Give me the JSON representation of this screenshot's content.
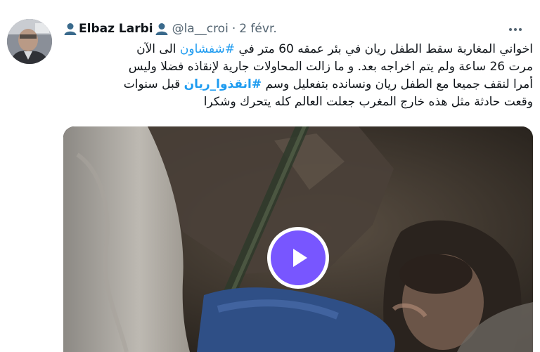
{
  "tweet": {
    "author_emoji": "bust-in-silhouette-icon",
    "author_name": "Elbaz Larbi",
    "handle": "@la__croi",
    "separator": "·",
    "date": "2 févr.",
    "more_icon": "more-horizontal-icon",
    "text": {
      "line1_a": "اخواني المغاربة سقط الطفل ريان في بئر عمقه 60 متر في ",
      "hashtag1": "#شفشاون",
      "line1_b": " الى الآن",
      "line2": "مرت 26 ساعة ولم يتم اخراجه بعد. و ما زالت المحاولات جارية لإنقاذه فضلا وليس",
      "line3_a": "أمرا لنقف جميعا مع الطفل ريان ونسانده بتفعليل وسم ",
      "hashtag2": "#انقذوا_ريان",
      "line3_b": "  قبل سنوات",
      "line4": "وقعت حادثة مثل هذه خارج المغرب جعلت العالم كله يتحرك وشكرا"
    },
    "media": {
      "type": "video",
      "play_icon": "play-icon",
      "accent_color": "#7856ff"
    }
  },
  "colors": {
    "link": "#1d9bf0",
    "text": "#0f1419",
    "secondary": "#536471"
  }
}
